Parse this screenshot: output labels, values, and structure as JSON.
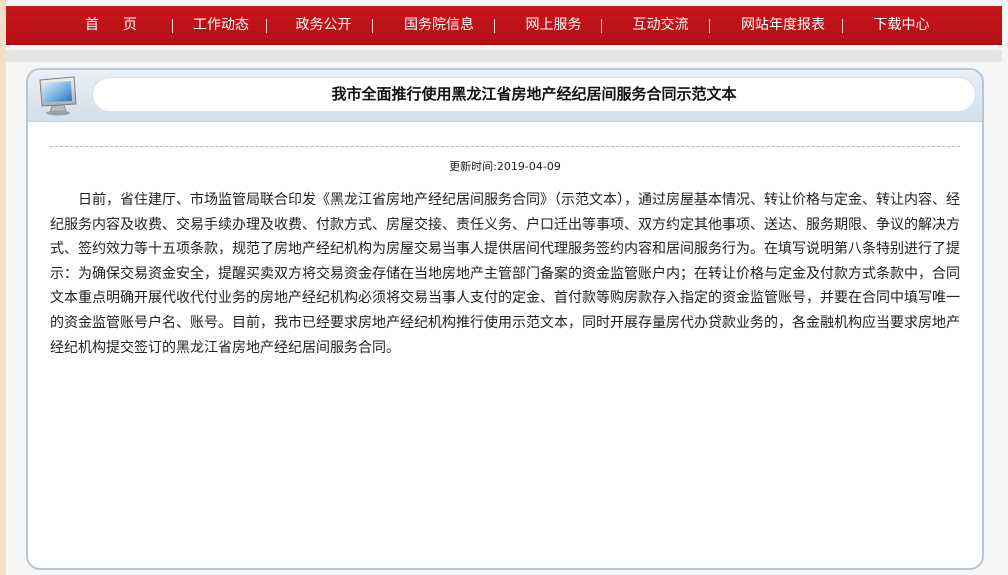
{
  "nav": {
    "items": [
      "首页",
      "工作动态",
      "政务公开",
      "国务院信息",
      "网上服务",
      "互动交流",
      "网站年度报表",
      "下载中心"
    ]
  },
  "article": {
    "title": "我市全面推行使用黑龙江省房地产经纪居间服务合同示范文本",
    "date_label": "更新时间:",
    "date": "2019-04-09",
    "body": "日前，省住建厅、市场监管局联合印发《黑龙江省房地产经纪居间服务合同》（示范文本），通过房屋基本情况、转让价格与定金、转让内容、经纪服务内容及收费、交易手续办理及收费、付款方式、房屋交接、责任义务、户口迁出等事项、双方约定其他事项、送达、服务期限、争议的解决方式、签约效力等十五项条款，规范了房地产经纪机构为房屋交易当事人提供居间代理服务签约内容和居间服务行为。在填写说明第八条特别进行了提示：为确保交易资金安全，提醒买卖双方将交易资金存储在当地房地产主管部门备案的资金监管账户内；在转让价格与定金及付款方式条款中，合同文本重点明确开展代收代付业务的房地产经纪机构必须将交易当事人支付的定金、首付款等购房款存入指定的资金监管账号，并要在合同中填写唯一的资金监管账号户名、账号。目前，我市已经要求房地产经纪机构推行使用示范文本，同时开展存量房代办贷款业务的，各金融机构应当要求房地产经纪机构提交签订的黑龙江省房地产经纪居间服务合同。"
  },
  "icons": {
    "panel_icon": "monitor-icon"
  },
  "colors": {
    "nav_bg": "#c8161d",
    "panel_border": "#b7c6d4"
  }
}
